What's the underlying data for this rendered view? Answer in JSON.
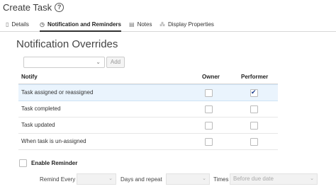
{
  "header": {
    "title": "Create Task",
    "help_icon": "help-circle-icon"
  },
  "tabs": [
    {
      "label": "Details",
      "icon": "details-icon",
      "active": false
    },
    {
      "label": "Notification and Reminders",
      "icon": "timer-icon",
      "active": true
    },
    {
      "label": "Notes",
      "icon": "notes-icon",
      "active": false
    },
    {
      "label": "Display Properties",
      "icon": "properties-icon",
      "active": false
    }
  ],
  "section": {
    "title": "Notification Overrides"
  },
  "toolbar": {
    "select_value": "",
    "add_label": "Add"
  },
  "table": {
    "columns": [
      "Notify",
      "Owner",
      "Performer"
    ],
    "rows": [
      {
        "label": "Task assigned or reassigned",
        "owner": false,
        "performer": true,
        "selected": true
      },
      {
        "label": "Task completed",
        "owner": false,
        "performer": false,
        "selected": false
      },
      {
        "label": "Task updated",
        "owner": false,
        "performer": false,
        "selected": false
      },
      {
        "label": "When task is un-assigned",
        "owner": false,
        "performer": false,
        "selected": false
      }
    ]
  },
  "reminder": {
    "label": "Enable Reminder",
    "enabled": false,
    "remind_every_label": "Remind Every",
    "days_repeat_label": "Days and repeat",
    "times_label": "Times",
    "times_placeholder": "Before due date"
  }
}
